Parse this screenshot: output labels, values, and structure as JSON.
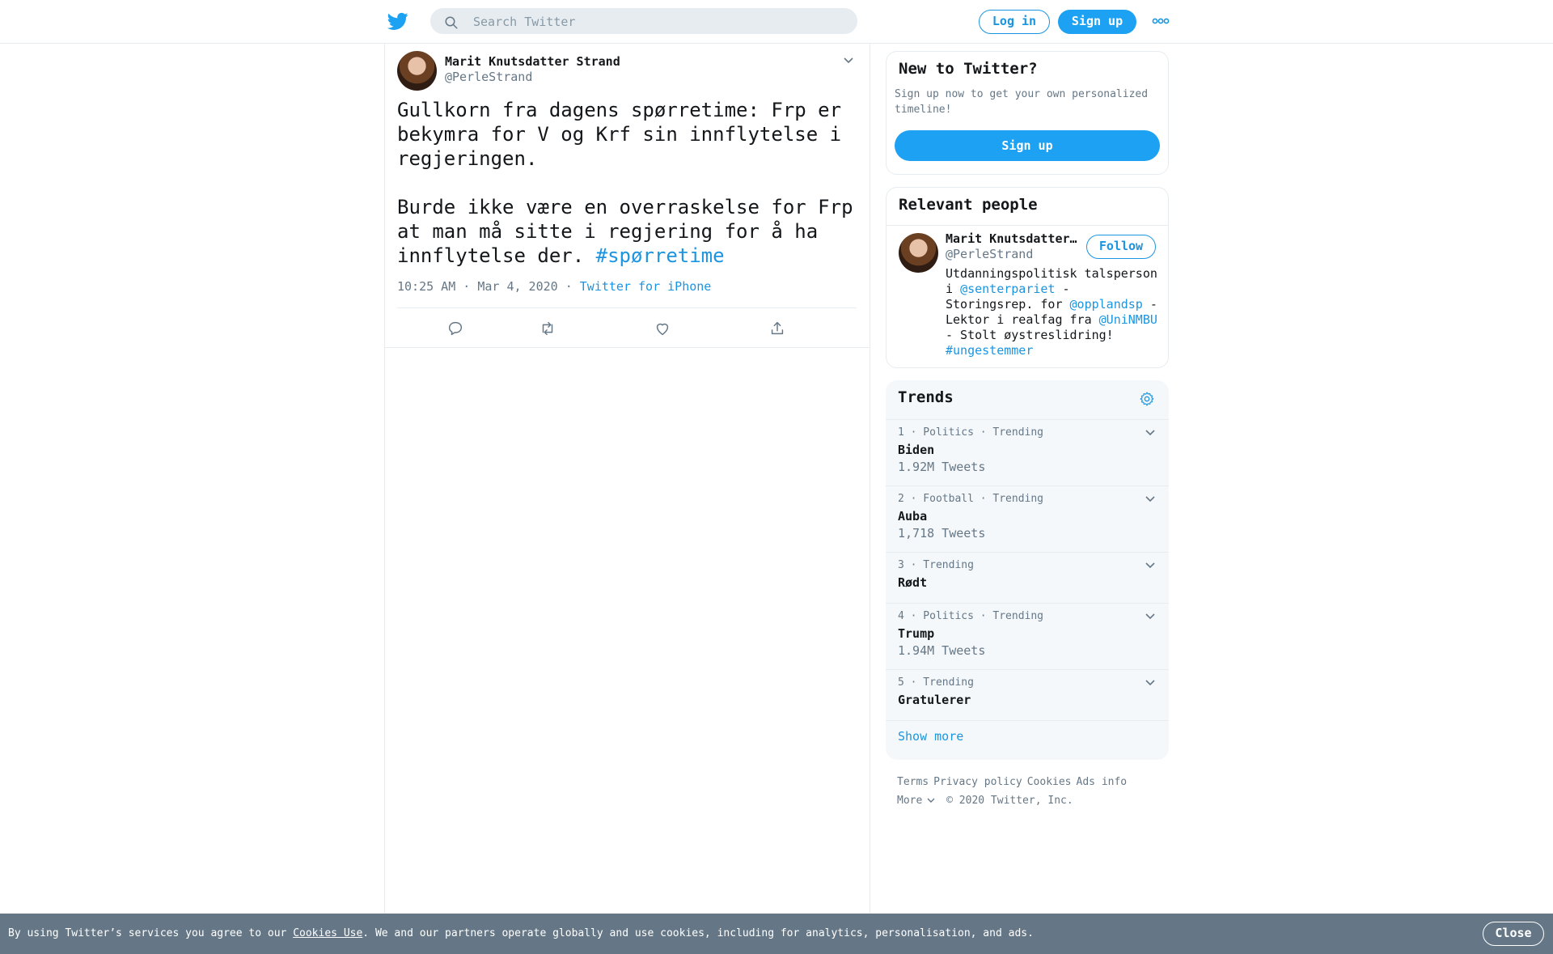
{
  "header": {
    "search_placeholder": "Search Twitter",
    "login_label": "Log in",
    "signup_label": "Sign up"
  },
  "tweet": {
    "author_name": "Marit Knutsdatter Strand",
    "author_handle": "@PerleStrand",
    "text_part1": "Gullkorn fra dagens spørretime: Frp er bekymra for V og Krf sin innflytelse i regjeringen.\n\nBurde ikke være en overraskelse for Frp at man må sitte i regjering for å ha innflytelse der. ",
    "hashtag": "#spørretime",
    "time": "10:25 AM · Mar 4, 2020",
    "separator": " · ",
    "source": "Twitter for iPhone"
  },
  "new_to_twitter": {
    "title": "New to Twitter?",
    "description": "Sign up now to get your own personalized timeline!",
    "signup_label": "Sign up"
  },
  "relevant_people": {
    "title": "Relevant people",
    "name": "Marit Knutsdatter Strand",
    "handle": "@PerleStrand",
    "follow_label": "Follow",
    "bio": {
      "t1": "Utdanningspolitisk talsperson i ",
      "l1": "@senterpariet",
      "t2": " - Storingsrep. for ",
      "l2": "@opplandsp",
      "t3": " - Lektor i realfag fra ",
      "l3": "@UniNMBU",
      "t4": " - Stolt øystreslidring! ",
      "l4": "#ungestemmer"
    }
  },
  "trends": {
    "title": "Trends",
    "items": [
      {
        "meta": "1 · Politics · Trending",
        "name": "Biden",
        "count": "1.92M Tweets"
      },
      {
        "meta": "2 · Football · Trending",
        "name": "Auba",
        "count": "1,718 Tweets"
      },
      {
        "meta": "3 · Trending",
        "name": "Rødt",
        "count": ""
      },
      {
        "meta": "4 · Politics · Trending",
        "name": "Trump",
        "count": "1.94M Tweets"
      },
      {
        "meta": "5 · Trending",
        "name": "Gratulerer",
        "count": ""
      }
    ],
    "show_more": "Show more"
  },
  "footer": {
    "terms": "Terms",
    "privacy": "Privacy policy",
    "cookies": "Cookies",
    "ads": "Ads info",
    "more": "More",
    "copyright": "© 2020 Twitter, Inc."
  },
  "cookie_bar": {
    "prefix": "By using Twitter’s services you agree to our ",
    "link": "Cookies Use",
    "suffix": ". We and our partners operate globally and use cookies, including for analytics, personalisation, and ads.",
    "close_label": "Close"
  },
  "colors": {
    "brand": "#1da1f2",
    "link": "#1b95e0",
    "muted": "#657786",
    "cookie_bar": "#657786"
  }
}
